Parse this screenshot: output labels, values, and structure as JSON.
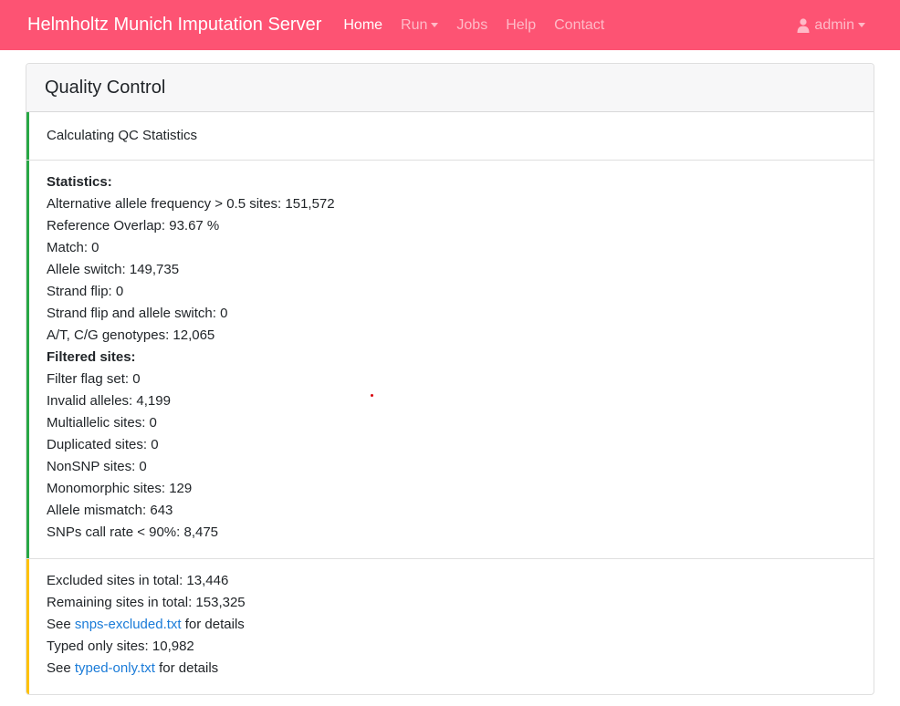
{
  "navbar": {
    "brand": "Helmholtz Munich Imputation Server",
    "items": [
      {
        "label": "Home"
      },
      {
        "label": "Run"
      },
      {
        "label": "Jobs"
      },
      {
        "label": "Help"
      },
      {
        "label": "Contact"
      }
    ],
    "user": {
      "label": "admin"
    }
  },
  "card": {
    "title": "Quality Control",
    "calculating": "Calculating QC Statistics",
    "stats": {
      "heading": "Statistics:",
      "lines": [
        "Alternative allele frequency > 0.5 sites: 151,572",
        "Reference Overlap: 93.67 %",
        "Match: 0",
        "Allele switch: 149,735",
        "Strand flip: 0",
        "Strand flip and allele switch: 0",
        "A/T, C/G genotypes: 12,065"
      ]
    },
    "filtered": {
      "heading": "Filtered sites:",
      "lines": [
        "Filter flag set: 0",
        "Invalid alleles: 4,199",
        "Multiallelic sites: 0",
        "Duplicated sites: 0",
        "NonSNP sites: 0",
        "Monomorphic sites: 129",
        "Allele mismatch: 643",
        "SNPs call rate < 90%: 8,475"
      ]
    },
    "summary": {
      "excluded": "Excluded sites in total: 13,446",
      "remaining": "Remaining sites in total: 153,325",
      "see_prefix": "See ",
      "excluded_file": "snps-excluded.txt",
      "details_suffix": " for details",
      "typed_only": "Typed only sites: 10,982",
      "typed_only_file": "typed-only.txt"
    }
  },
  "colors": {
    "navbar": "#fd5373",
    "success_border": "#28a745",
    "warning_border": "#ffc107",
    "link": "#1a7bd8"
  }
}
